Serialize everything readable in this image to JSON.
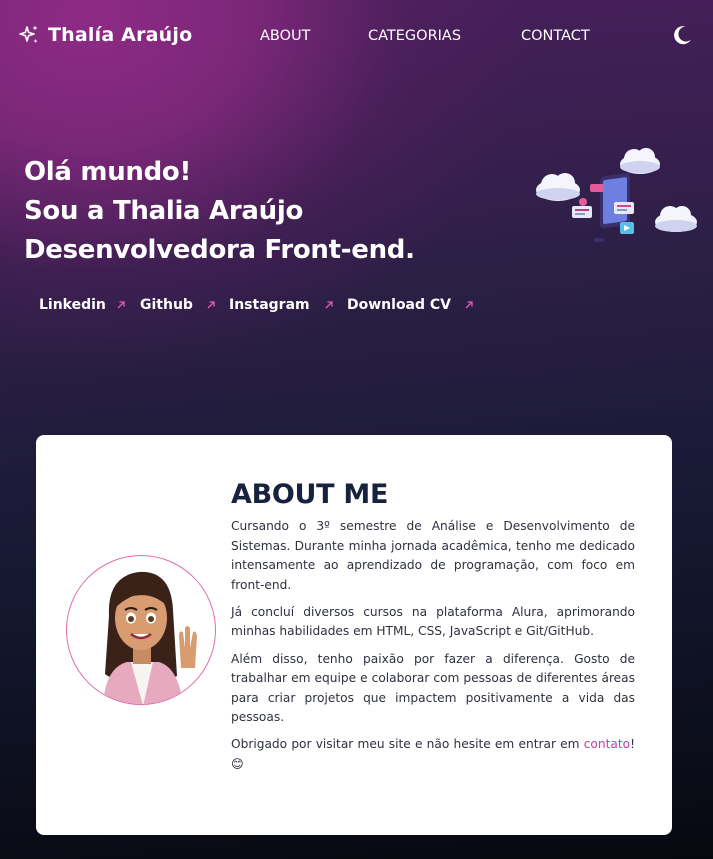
{
  "header": {
    "brand_name": "Thalía Araújo",
    "brand_icon": "sparkles-icon",
    "nav": [
      "ABOUT",
      "CATEGORIAS",
      "CONTACT"
    ],
    "theme_toggle_icon": "moon-icon"
  },
  "hero": {
    "lines": [
      "Olá mundo!",
      "Sou a Thalia Araújo",
      "Desenvolvedora Front-end."
    ],
    "links": [
      "Linkedin",
      "Github",
      "Instagram",
      "Download CV"
    ],
    "link_icon": "arrow-up-right-icon",
    "illustration": "social-media-phone-clouds-illustration"
  },
  "about": {
    "title": "ABOUT ME",
    "paragraphs": [
      "Cursando o 3º semestre de Análise e Desenvolvimento de Sistemas. Durante minha jornada acadêmica, tenho me dedicado intensamente ao aprendizado de programação, com foco em front-end.",
      "Já concluí diversos cursos na plataforma Alura, aprimorando minhas habilidades em HTML, CSS, JavaScript e Git/GitHub.",
      "Além disso, tenho paixão por fazer a diferença. Gosto de trabalhar em equipe e colaborar com pessoas de diferentes áreas para criar projetos que impactem positivamente a vida das pessoas."
    ],
    "closing_text": "Obrigado por visitar meu site e não hesite em entrar em ",
    "contact_link": "contato",
    "closing_end": "! 😊",
    "avatar": "cartoon-avatar-waving"
  },
  "colors": {
    "accent": "#e05cb5",
    "card_title": "#17223f",
    "link_pink": "#c93aa3"
  }
}
